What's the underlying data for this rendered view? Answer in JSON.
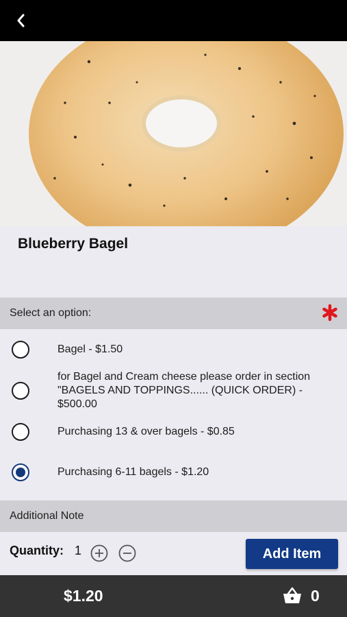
{
  "product": {
    "name": "Blueberry Bagel",
    "image_alt": "bagel"
  },
  "options_section": {
    "heading": "Select an option:",
    "required": true,
    "items": [
      {
        "label": "Bagel - $1.50",
        "selected": false
      },
      {
        "label": "for Bagel and Cream cheese please order in section \"BAGELS AND TOPPINGS...... (QUICK ORDER) - $500.00",
        "selected": false
      },
      {
        "label": "Purchasing 13 & over bagels - $0.85",
        "selected": false
      },
      {
        "label": "Purchasing 6-11 bagels - $1.20",
        "selected": true
      }
    ]
  },
  "note_section": {
    "heading": "Additional Note"
  },
  "quantity": {
    "label": "Quantity:",
    "value": "1"
  },
  "add_button": {
    "label": "Add Item"
  },
  "footer": {
    "total": "$1.20",
    "cart_count": "0"
  },
  "colors": {
    "primary": "#123a86",
    "required": "#e0171c",
    "footer_bg": "#333333"
  },
  "icons": {
    "back": "chevron-left-icon",
    "required": "asterisk-icon",
    "plus": "plus-circle-icon",
    "minus": "minus-circle-icon",
    "cart": "basket-icon"
  }
}
